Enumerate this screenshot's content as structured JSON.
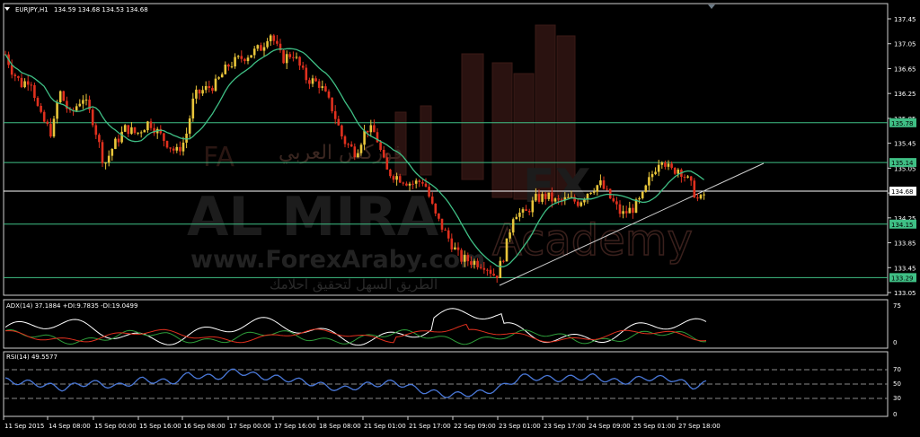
{
  "main_panel": {
    "symbol_label": "EURJPY,H1",
    "ohlc_label": "134.59 134.68 134.53 134.68",
    "price_ticks": [
      "137.45",
      "137.05",
      "136.65",
      "136.25",
      "135.85",
      "135.45",
      "135.05",
      "134.65",
      "134.25",
      "133.85",
      "133.45",
      "133.05"
    ],
    "tags": [
      {
        "label": "135.78",
        "value": 135.78,
        "color": "#3fbf85"
      },
      {
        "label": "135.14",
        "value": 135.14,
        "color": "#3fbf85"
      },
      {
        "label": "134.68",
        "value": 134.68,
        "color": "#ffffff"
      },
      {
        "label": "134.15",
        "value": 134.15,
        "color": "#3fbf85"
      },
      {
        "label": "133.29",
        "value": 133.29,
        "color": "#3fbf85"
      }
    ]
  },
  "watermark": {
    "brand_en": "AL MIRA",
    "brand_fx": "FX",
    "website": "www.ForexAraby.com",
    "academy": "Academy",
    "brand_ar": "فوركس العربي",
    "tagline_ar": "الطريق السهل لتحقيق احلامك"
  },
  "adx_panel": {
    "label": "ADX(14) 37.1884 +DI:9.7835 -DI:19.0499",
    "ticks": [
      "75",
      "0"
    ]
  },
  "rsi_panel": {
    "label": "RSI(14) 49.5577",
    "ticks": [
      "70",
      "50",
      "30",
      "0"
    ]
  },
  "time_axis": {
    "labels": [
      "11 Sep 2015",
      "14 Sep 08:00",
      "15 Sep 00:00",
      "15 Sep 16:00",
      "16 Sep 08:00",
      "17 Sep 00:00",
      "17 Sep 16:00",
      "18 Sep 08:00",
      "21 Sep 01:00",
      "21 Sep 17:00",
      "22 Sep 09:00",
      "23 Sep 01:00",
      "23 Sep 17:00",
      "24 Sep 09:00",
      "25 Sep 01:00",
      "27 Sep 18:00"
    ]
  },
  "colors": {
    "bull": "#e8c53a",
    "bear": "#e0301e",
    "ma": "#3fbf85",
    "adx": "#ffffff",
    "di_plus": "#2e9e3a",
    "di_minus": "#e0301e",
    "rsi": "#4a78d8"
  }
}
